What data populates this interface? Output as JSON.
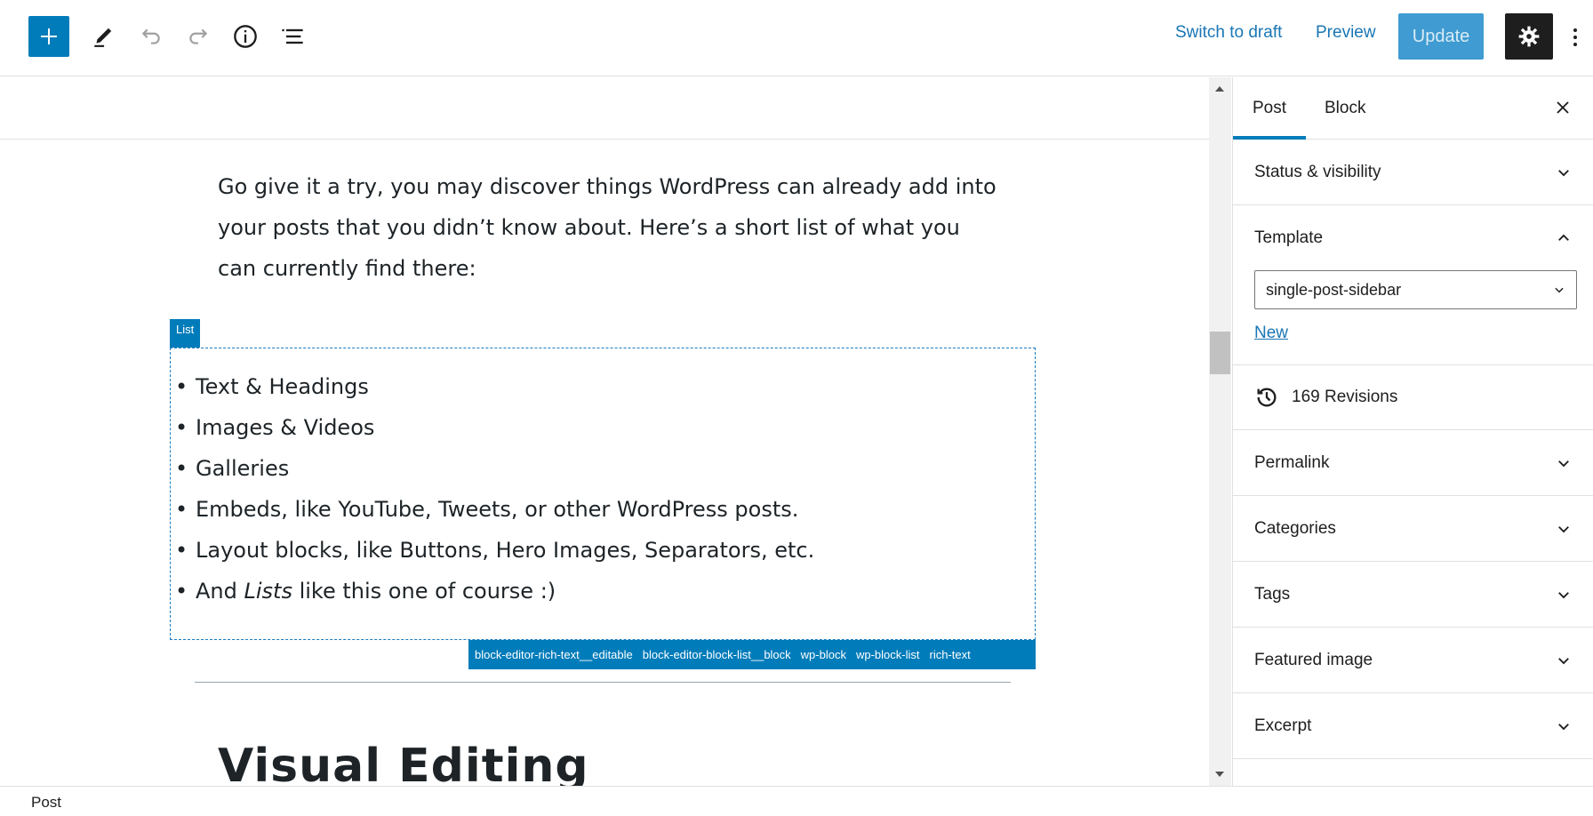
{
  "toolbar": {
    "add_icon": "plus-icon",
    "tools_icon": "pencil-icon",
    "undo_icon": "undo-icon",
    "redo_icon": "redo-icon",
    "details_icon": "info-icon",
    "outline_icon": "list-view-icon",
    "switch_to_draft": "Switch to draft",
    "preview": "Preview",
    "update": "Update",
    "settings_icon": "gear-icon",
    "more_icon": "more-vertical-icon"
  },
  "editor": {
    "paragraph": "Go give it a try, you may discover things WordPress can already add into your posts that you didn’t know about. Here’s a short list of what you can currently find there:",
    "list_label": "List",
    "list_items": {
      "0": "Text & Headings",
      "1": "Images & Videos",
      "2": "Galleries",
      "3": "Embeds, like YouTube, Tweets, or other WordPress posts.",
      "4": "Layout blocks, like Buttons, Hero Images, Separators, etc.",
      "5_before": "And ",
      "5_em": "Lists",
      "5_after": " like this one of course :)"
    },
    "class_names": [
      "block-editor-rich-text__editable",
      "block-editor-block-list__block",
      "wp-block",
      "wp-block-list",
      "rich-text"
    ],
    "heading": "Visual Editing"
  },
  "sidebar": {
    "tab_post": "Post",
    "tab_block": "Block",
    "close_icon": "close-icon",
    "status_visibility": "Status & visibility",
    "template_title": "Template",
    "template_value": "single-post-sidebar",
    "template_new": "New",
    "revisions": "169 Revisions",
    "permalink": "Permalink",
    "categories": "Categories",
    "tags": "Tags",
    "featured_image": "Featured image",
    "excerpt": "Excerpt"
  },
  "footer": {
    "breadcrumb": "Post"
  },
  "colors": {
    "accent": "#007cba",
    "link": "#1a76b4",
    "dark": "#1e1e1e"
  }
}
